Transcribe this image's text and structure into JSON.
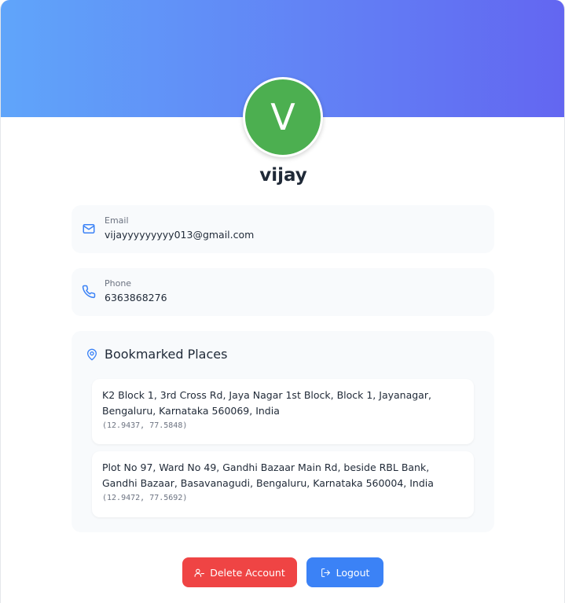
{
  "profile": {
    "avatar_initial": "V",
    "username": "vijay"
  },
  "colors": {
    "banner_start": "#60a5fa",
    "banner_end": "#6366f1",
    "avatar_bg": "#4caf50",
    "accent": "#3b82f6",
    "danger": "#ef4444"
  },
  "email": {
    "icon": "mail-icon",
    "label": "Email",
    "value": "vijayyyyyyyyy013@gmail.com"
  },
  "phone": {
    "icon": "phone-icon",
    "label": "Phone",
    "value": "6363868276"
  },
  "bookmarks": {
    "icon": "map-pin-icon",
    "title": "Bookmarked Places",
    "places": [
      {
        "address": "K2 Block 1, 3rd Cross Rd, Jaya Nagar 1st Block, Block 1, Jayanagar, Bengaluru, Karnataka 560069, India",
        "coords": "(12.9437, 77.5848)"
      },
      {
        "address": "Plot No 97, Ward No 49, Gandhi Bazaar Main Rd, beside RBL Bank, Gandhi Bazaar, Basavanagudi, Bengaluru, Karnataka 560004, India",
        "coords": "(12.9472, 77.5692)"
      }
    ]
  },
  "actions": {
    "delete_label": "Delete Account",
    "delete_icon": "user-minus-icon",
    "logout_label": "Logout",
    "logout_icon": "logout-icon"
  }
}
